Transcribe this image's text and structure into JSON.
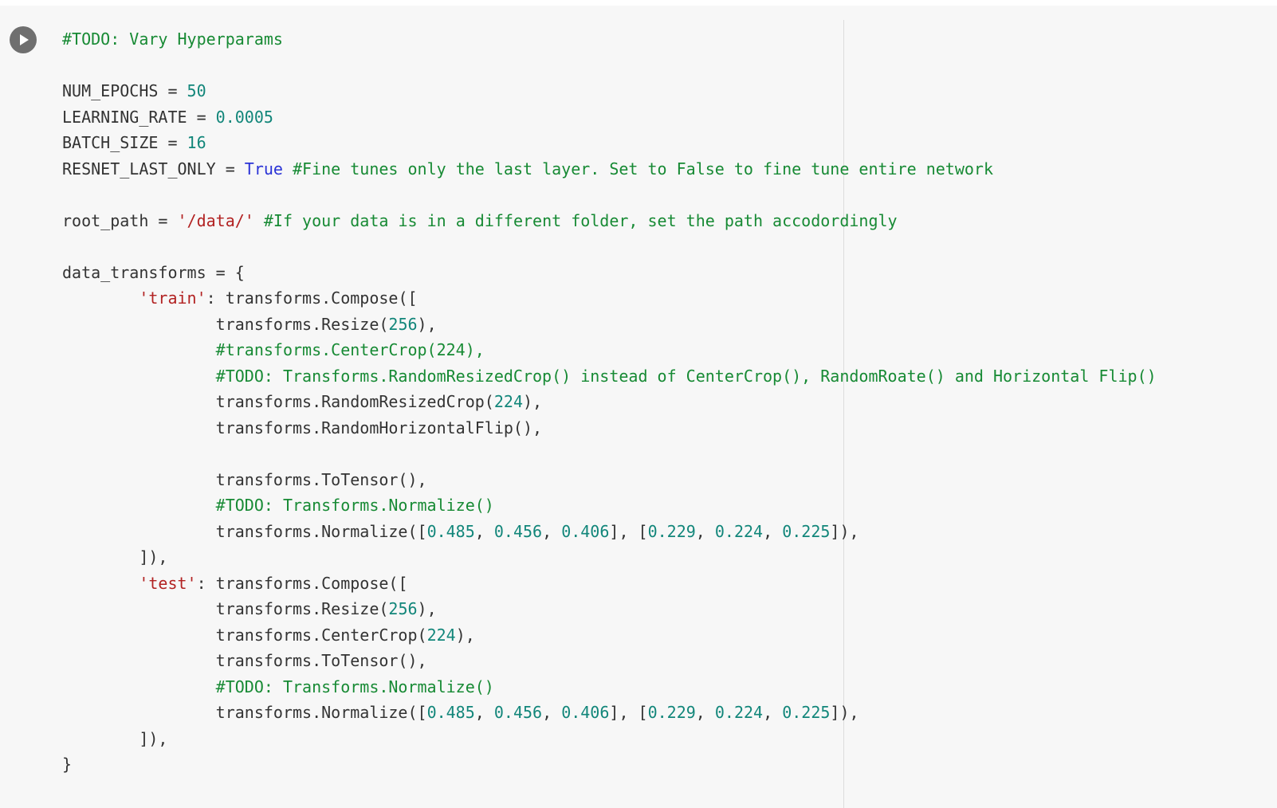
{
  "cell": {
    "run_button_icon": "play-icon",
    "lines": [
      [
        {
          "t": "#TODO: Vary Hyperparams",
          "c": "comment"
        }
      ],
      [],
      [
        {
          "t": "NUM_EPOCHS = ",
          "c": "plain"
        },
        {
          "t": "50",
          "c": "number"
        }
      ],
      [
        {
          "t": "LEARNING_RATE = ",
          "c": "plain"
        },
        {
          "t": "0.0005",
          "c": "number"
        }
      ],
      [
        {
          "t": "BATCH_SIZE = ",
          "c": "plain"
        },
        {
          "t": "16",
          "c": "number"
        }
      ],
      [
        {
          "t": "RESNET_LAST_ONLY = ",
          "c": "plain"
        },
        {
          "t": "True",
          "c": "keyword"
        },
        {
          "t": " ",
          "c": "plain"
        },
        {
          "t": "#Fine tunes only the last layer. Set to False to fine tune entire network",
          "c": "comment"
        }
      ],
      [],
      [
        {
          "t": "root_path = ",
          "c": "plain"
        },
        {
          "t": "'/data/'",
          "c": "string"
        },
        {
          "t": " ",
          "c": "plain"
        },
        {
          "t": "#If your data is in a different folder, set the path accodordingly",
          "c": "comment"
        }
      ],
      [],
      [
        {
          "t": "data_transforms = {",
          "c": "plain"
        }
      ],
      [
        {
          "t": "        ",
          "c": "plain"
        },
        {
          "t": "'train'",
          "c": "string"
        },
        {
          "t": ": transforms.Compose([",
          "c": "plain"
        }
      ],
      [
        {
          "t": "                transforms.Resize(",
          "c": "plain"
        },
        {
          "t": "256",
          "c": "number"
        },
        {
          "t": "),",
          "c": "plain"
        }
      ],
      [
        {
          "t": "                ",
          "c": "plain"
        },
        {
          "t": "#transforms.CenterCrop(224),",
          "c": "comment"
        }
      ],
      [
        {
          "t": "                ",
          "c": "plain"
        },
        {
          "t": "#TODO: Transforms.RandomResizedCrop() instead of CenterCrop(), RandomRoate() and Horizontal Flip()",
          "c": "comment"
        }
      ],
      [
        {
          "t": "                transforms.RandomResizedCrop(",
          "c": "plain"
        },
        {
          "t": "224",
          "c": "number"
        },
        {
          "t": "),",
          "c": "plain"
        }
      ],
      [
        {
          "t": "                transforms.RandomHorizontalFlip(),",
          "c": "plain"
        }
      ],
      [],
      [
        {
          "t": "                transforms.ToTensor(),",
          "c": "plain"
        }
      ],
      [
        {
          "t": "                ",
          "c": "plain"
        },
        {
          "t": "#TODO: Transforms.Normalize()",
          "c": "comment"
        }
      ],
      [
        {
          "t": "                transforms.Normalize([",
          "c": "plain"
        },
        {
          "t": "0.485",
          "c": "number"
        },
        {
          "t": ", ",
          "c": "plain"
        },
        {
          "t": "0.456",
          "c": "number"
        },
        {
          "t": ", ",
          "c": "plain"
        },
        {
          "t": "0.406",
          "c": "number"
        },
        {
          "t": "], [",
          "c": "plain"
        },
        {
          "t": "0.229",
          "c": "number"
        },
        {
          "t": ", ",
          "c": "plain"
        },
        {
          "t": "0.224",
          "c": "number"
        },
        {
          "t": ", ",
          "c": "plain"
        },
        {
          "t": "0.225",
          "c": "number"
        },
        {
          "t": "]),",
          "c": "plain"
        }
      ],
      [
        {
          "t": "        ]),",
          "c": "plain"
        }
      ],
      [
        {
          "t": "        ",
          "c": "plain"
        },
        {
          "t": "'test'",
          "c": "string"
        },
        {
          "t": ": transforms.Compose([",
          "c": "plain"
        }
      ],
      [
        {
          "t": "                transforms.Resize(",
          "c": "plain"
        },
        {
          "t": "256",
          "c": "number"
        },
        {
          "t": "),",
          "c": "plain"
        }
      ],
      [
        {
          "t": "                transforms.CenterCrop(",
          "c": "plain"
        },
        {
          "t": "224",
          "c": "number"
        },
        {
          "t": "),",
          "c": "plain"
        }
      ],
      [
        {
          "t": "                transforms.ToTensor(),",
          "c": "plain"
        }
      ],
      [
        {
          "t": "                ",
          "c": "plain"
        },
        {
          "t": "#TODO: Transforms.Normalize()",
          "c": "comment"
        }
      ],
      [
        {
          "t": "                transforms.Normalize([",
          "c": "plain"
        },
        {
          "t": "0.485",
          "c": "number"
        },
        {
          "t": ", ",
          "c": "plain"
        },
        {
          "t": "0.456",
          "c": "number"
        },
        {
          "t": ", ",
          "c": "plain"
        },
        {
          "t": "0.406",
          "c": "number"
        },
        {
          "t": "], [",
          "c": "plain"
        },
        {
          "t": "0.229",
          "c": "number"
        },
        {
          "t": ", ",
          "c": "plain"
        },
        {
          "t": "0.224",
          "c": "number"
        },
        {
          "t": ", ",
          "c": "plain"
        },
        {
          "t": "0.225",
          "c": "number"
        },
        {
          "t": "]),",
          "c": "plain"
        }
      ],
      [
        {
          "t": "        ]),",
          "c": "plain"
        }
      ],
      [
        {
          "t": "}",
          "c": "plain"
        }
      ]
    ]
  }
}
